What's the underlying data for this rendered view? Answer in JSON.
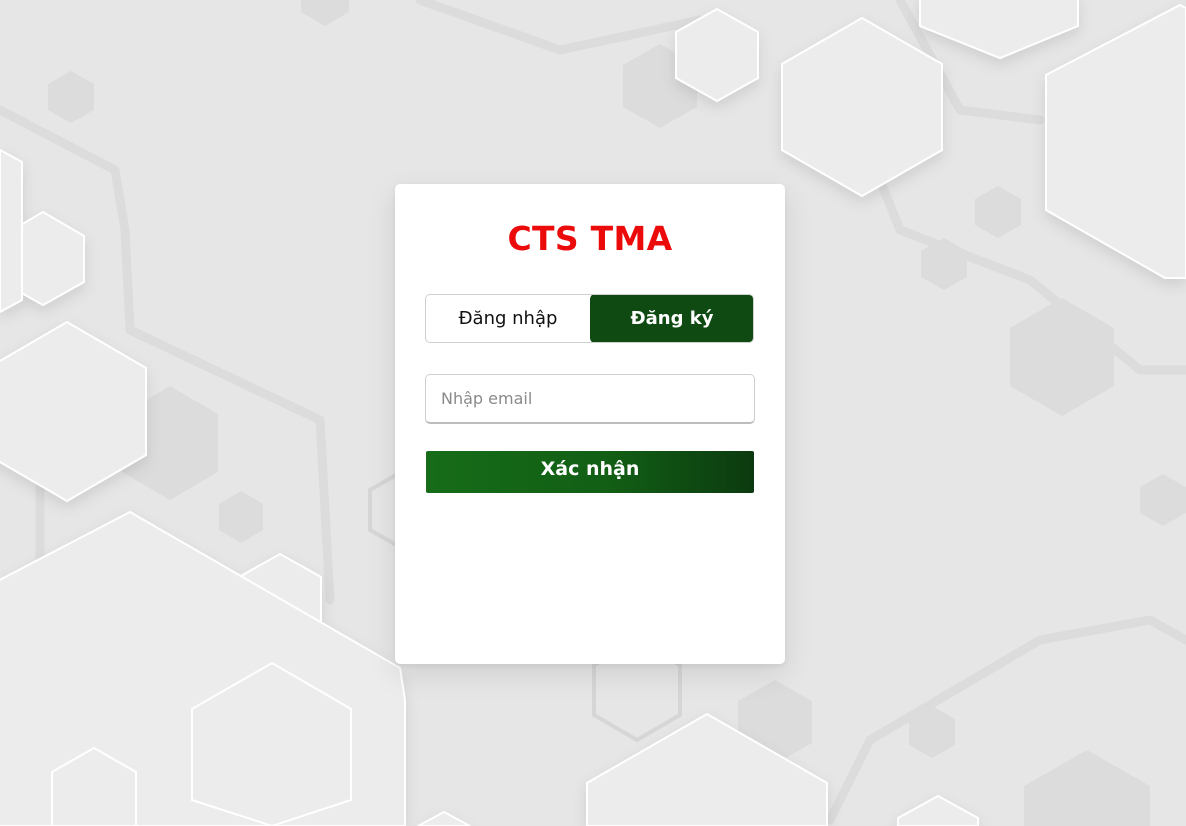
{
  "app": {
    "title": "CTS TMA"
  },
  "tabs": [
    {
      "label": "Đăng nhập",
      "active": false
    },
    {
      "label": "Đăng ký",
      "active": true
    }
  ],
  "form": {
    "email_placeholder": "Nhập email",
    "email_value": "",
    "submit_label": "Xác nhận"
  },
  "colors": {
    "title": "#ec0b0b",
    "accent_dark_green": "#0e4a12",
    "button_green": "#166c18",
    "background": "#e6e6e7"
  }
}
